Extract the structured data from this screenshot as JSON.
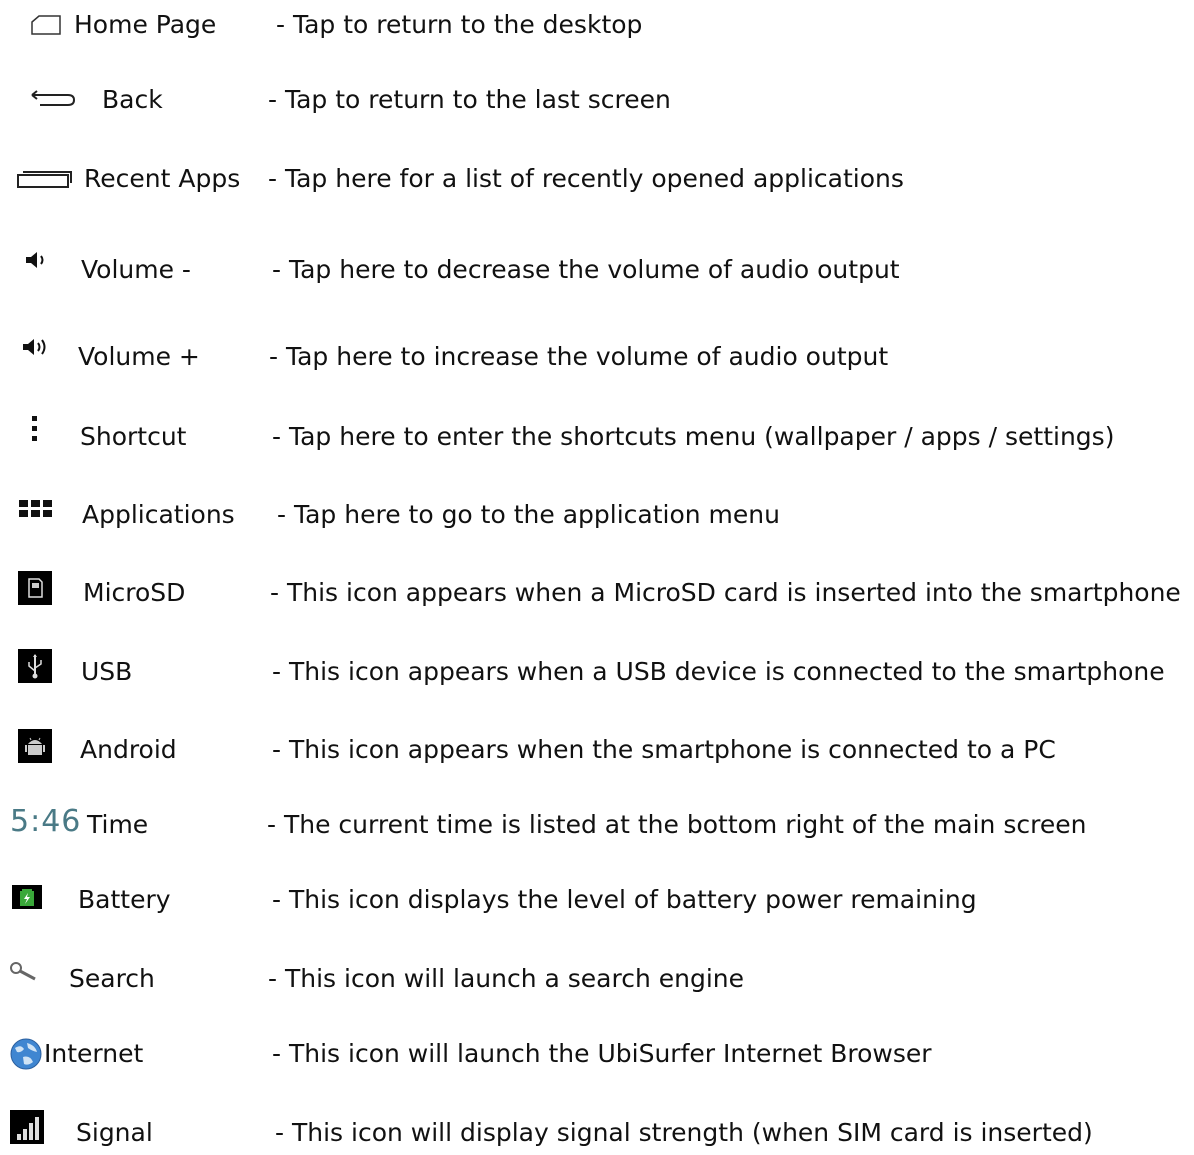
{
  "items": [
    {
      "icon": "home-icon",
      "label": "Home Page",
      "desc": "-  Tap to return to the desktop"
    },
    {
      "icon": "back-icon",
      "label": "Back",
      "desc": "- Tap to return to the last screen"
    },
    {
      "icon": "recent-apps-icon",
      "label": "Recent Apps",
      "desc": "- Tap here for a list of recently opened applications"
    },
    {
      "icon": "volume-down-icon",
      "label": "Volume -",
      "desc": "- Tap here to decrease the volume of audio output"
    },
    {
      "icon": "volume-up-icon",
      "label": "Volume +",
      "desc": "- Tap here to increase the volume of audio output"
    },
    {
      "icon": "menu-dots-icon",
      "label": "Shortcut",
      "desc": "- Tap here to enter the shortcuts menu (wallpaper / apps / settings)"
    },
    {
      "icon": "apps-grid-icon",
      "label": "Applications",
      "desc": "- Tap here to go to the application menu"
    },
    {
      "icon": "microsd-icon",
      "label": "MicroSD",
      "desc": "- This icon appears when a MicroSD card is inserted into the smartphone"
    },
    {
      "icon": "usb-icon",
      "label": "USB",
      "desc": "- This icon appears when a USB device is connected to the smartphone"
    },
    {
      "icon": "android-icon",
      "label": "Android",
      "desc": "- This icon appears when the smartphone is connected to a PC"
    },
    {
      "icon": "clock-icon",
      "icon_text": "5:46",
      "label": "Time",
      "desc": "- The current time is listed at the bottom right of the main screen"
    },
    {
      "icon": "battery-icon",
      "label": "Battery",
      "desc": "- This icon displays the level of battery power remaining"
    },
    {
      "icon": "search-icon",
      "label": "Search",
      "desc": "-   This icon will launch a search engine"
    },
    {
      "icon": "globe-icon",
      "label": "Internet",
      "desc": "-   This icon will launch the UbiSurfer Internet Browser"
    },
    {
      "icon": "signal-icon",
      "label": "Signal",
      "desc": "-   This icon will display signal strength (when SIM card is inserted)"
    }
  ],
  "colors": {
    "text": "#111111",
    "time_icon": "#4a7a86",
    "battery_green": "#3aa83a",
    "globe_blue": "#3f86d1"
  }
}
